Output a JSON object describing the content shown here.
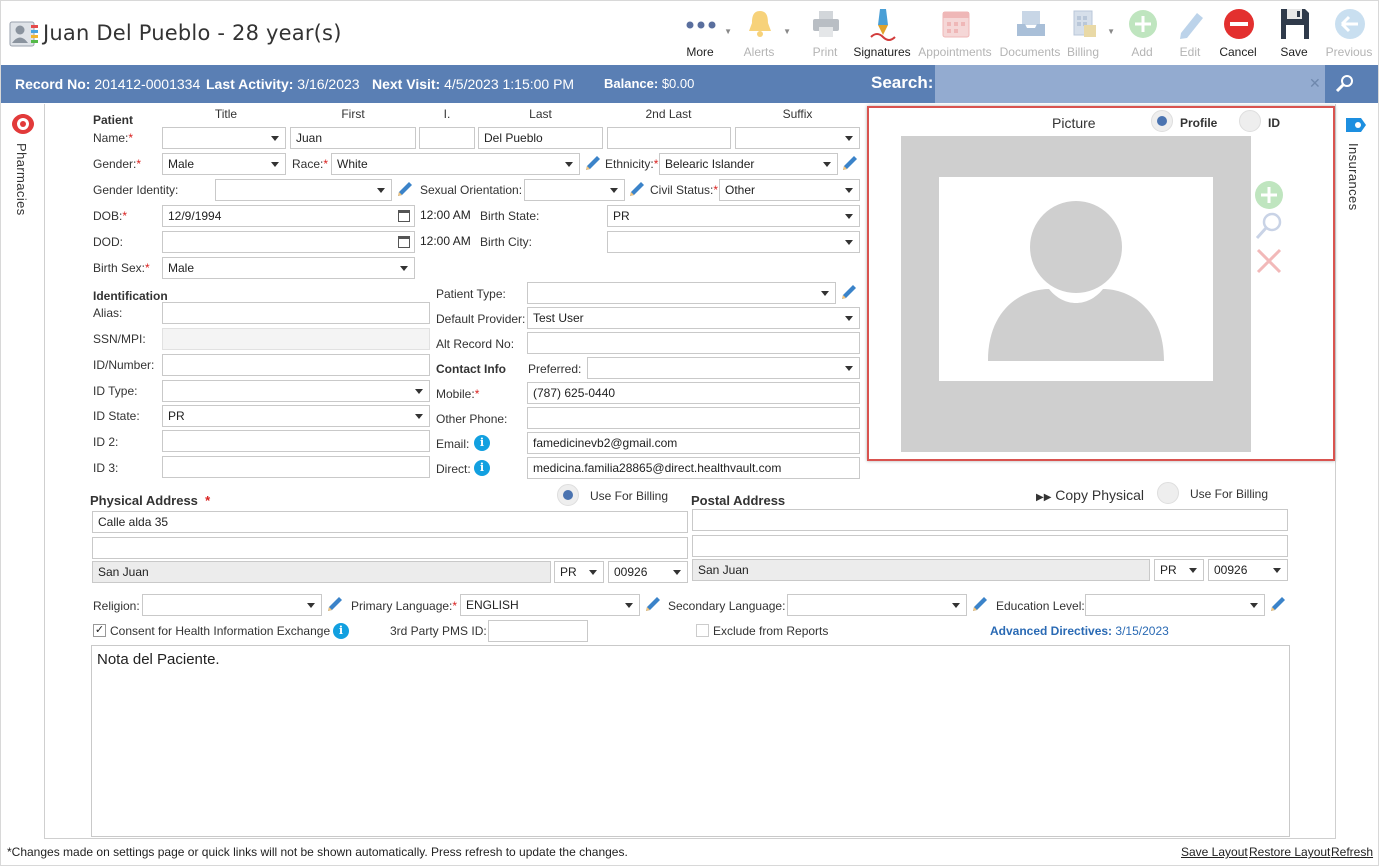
{
  "header": {
    "patient_name": "Juan Del Pueblo - 28 year(s)"
  },
  "toolbar": {
    "more": "More",
    "alerts": "Alerts",
    "print": "Print",
    "signatures": "Signatures",
    "appointments": "Appointments",
    "documents": "Documents",
    "billing": "Billing",
    "add": "Add",
    "edit": "Edit",
    "cancel": "Cancel",
    "save": "Save",
    "previous": "Previous"
  },
  "record_bar": {
    "record_no_label": "Record No:",
    "record_no": "201412-0001334",
    "last_activity_label": "Last Activity:",
    "last_activity": "3/16/2023",
    "next_visit_label": "Next Visit:",
    "next_visit": "4/5/2023 1:15:00 PM",
    "balance_label": "Balance:",
    "balance": "$0.00",
    "search_label": "Search:",
    "search_value": ""
  },
  "side_tabs": {
    "pharmacies": "Pharmacies",
    "insurances": "Insurances"
  },
  "patient": {
    "section": "Patient",
    "col_title": "Title",
    "col_first": "First",
    "col_initial": "I.",
    "col_last": "Last",
    "col_2nd_last": "2nd Last",
    "col_suffix": "Suffix",
    "name_label": "Name:",
    "title": "",
    "first": "Juan",
    "initial": "",
    "last": "Del Pueblo",
    "second_last": "",
    "suffix": "",
    "gender_label": "Gender:",
    "gender": "Male",
    "race_label": "Race:",
    "race": "White",
    "ethnicity_label": "Ethnicity:",
    "ethnicity": "Belearic Islander",
    "gender_identity_label": "Gender Identity:",
    "gender_identity": "",
    "sexual_orientation_label": "Sexual Orientation:",
    "sexual_orientation": "",
    "civil_status_label": "Civil Status:",
    "civil_status": "Other",
    "dob_label": "DOB:",
    "dob": "12/9/1994",
    "dob_time": "12:00 AM",
    "birth_state_label": "Birth State:",
    "birth_state": "PR",
    "dod_label": "DOD:",
    "dod": "",
    "dod_time": "12:00 AM",
    "birth_city_label": "Birth City:",
    "birth_city": "",
    "birth_sex_label": "Birth Sex:",
    "birth_sex": "Male"
  },
  "identification": {
    "section": "Identification",
    "alias_label": "Alias:",
    "alias": "",
    "ssn_label": "SSN/MPI:",
    "ssn": "",
    "id_number_label": "ID/Number:",
    "id_number": "",
    "id_type_label": "ID Type:",
    "id_type": "",
    "id_state_label": "ID State:",
    "id_state": "PR",
    "id2_label": "ID 2:",
    "id2": "",
    "id3_label": "ID 3:",
    "id3": "",
    "patient_type_label": "Patient Type:",
    "patient_type": "",
    "default_provider_label": "Default Provider:",
    "default_provider": "Test User",
    "alt_record_label": "Alt Record No:",
    "alt_record": ""
  },
  "contact": {
    "section": "Contact Info",
    "preferred_label": "Preferred:",
    "preferred": "",
    "mobile_label": "Mobile:",
    "mobile": "(787) 625-0440",
    "other_phone_label": "Other Phone:",
    "other_phone": "",
    "email_label": "Email:",
    "email": "famedicinevb2@gmail.com",
    "direct_label": "Direct:",
    "direct": "medicina.familia28865@direct.healthvault.com"
  },
  "picture": {
    "title": "Picture",
    "profile_label": "Profile",
    "id_label": "ID",
    "selected": "Profile"
  },
  "physical_address": {
    "title": "Physical Address",
    "use_for_billing": "Use For Billing",
    "line1": "Calle alda 35",
    "line2": "",
    "city": "San Juan",
    "state": "PR",
    "zip": "00926"
  },
  "postal_address": {
    "title": "Postal Address",
    "copy_physical": "Copy Physical",
    "use_for_billing": "Use For Billing",
    "line1": "",
    "line2": "",
    "city": "San Juan",
    "state": "PR",
    "zip": "00926"
  },
  "other": {
    "religion_label": "Religion:",
    "religion": "",
    "primary_language_label": "Primary Language:",
    "primary_language": "ENGLISH",
    "secondary_language_label": "Secondary Language:",
    "secondary_language": "",
    "education_level_label": "Education Level:",
    "education_level": "",
    "consent_label": "Consent for Health Information Exchange",
    "third_party_label": "3rd Party PMS ID:",
    "third_party": "",
    "exclude_label": "Exclude from Reports",
    "advanced_directives_label": "Advanced Directives:",
    "advanced_directives": "3/15/2023"
  },
  "notes": "Nota del Paciente.",
  "footer": {
    "note": "*Changes made on settings page or quick links will not be shown automatically. Press refresh to update the changes.",
    "save_layout": "Save Layout",
    "restore_layout": "Restore Layout",
    "refresh": "Refresh"
  },
  "colors": {
    "record_bar": "#5a7fb4",
    "accent_red": "#d9534f",
    "required": "#d9211f",
    "link_blue": "#2a6ab4",
    "info_blue": "#12a0e0"
  }
}
